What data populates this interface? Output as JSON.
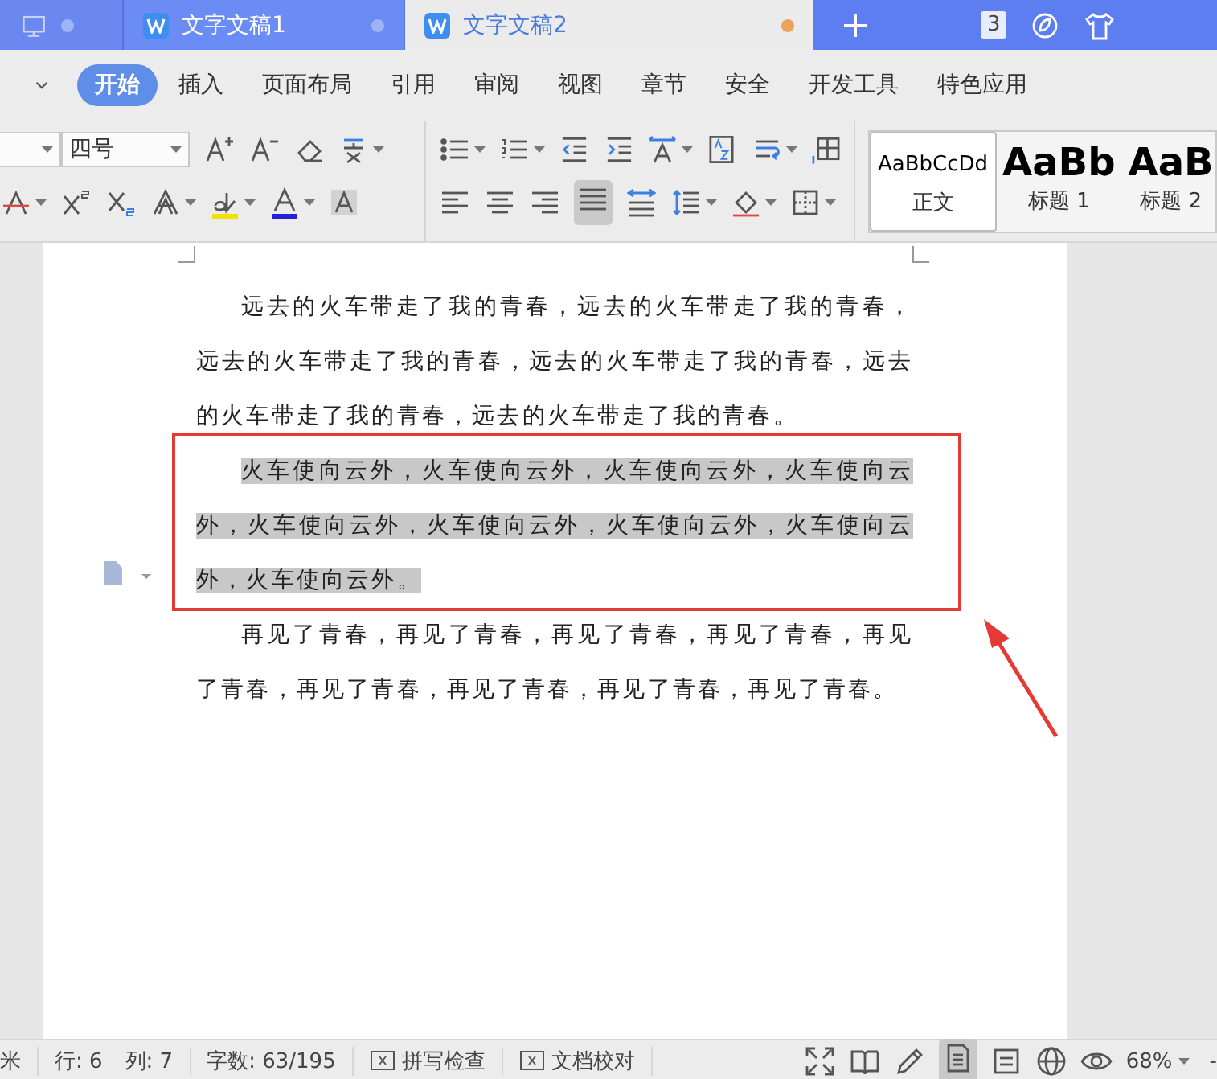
{
  "window_tabs": [
    {
      "kind": "home",
      "selected": false,
      "unsaved": false
    },
    {
      "kind": "doc",
      "title": "文字文稿1",
      "selected": false,
      "unsaved": false
    },
    {
      "kind": "doc",
      "title": "文字文稿2",
      "selected": true,
      "unsaved": true
    }
  ],
  "window_count": "3",
  "ribbon_tabs": [
    {
      "label": "开始",
      "selected": true
    },
    {
      "label": "插入",
      "selected": false
    },
    {
      "label": "页面布局",
      "selected": false
    },
    {
      "label": "引用",
      "selected": false
    },
    {
      "label": "审阅",
      "selected": false
    },
    {
      "label": "视图",
      "selected": false
    },
    {
      "label": "章节",
      "selected": false
    },
    {
      "label": "安全",
      "selected": false
    },
    {
      "label": "开发工具",
      "selected": false
    },
    {
      "label": "特色应用",
      "selected": false
    }
  ],
  "font_size": "四号",
  "styles": [
    {
      "kind": "body",
      "preview": "AaBbCcDd",
      "name": "正文",
      "selected": true
    },
    {
      "kind": "heading",
      "preview": "AaBb",
      "name": "标题 1",
      "selected": false
    },
    {
      "kind": "heading",
      "preview": "AaB",
      "name": "标题 2",
      "selected": false
    }
  ],
  "paragraphs": [
    {
      "text": "远去的火车带走了我的青春，远去的火车带走了我的青春，远去的火车带走了我的青春，远去的火车带走了我的青春，远去的火车带走了我的青春，远去的火车带走了我的青春。",
      "selected": false
    },
    {
      "text": "火车使向云外，火车使向云外，火车使向云外，火车使向云外，火车使向云外，火车使向云外，火车使向云外，火车使向云外，火车使向云外。",
      "selected": true
    },
    {
      "text": "再见了青春，再见了青春，再见了青春，再见了青春，再见了青春，再见了青春，再见了青春，再见了青春，再见了青春。",
      "selected": false
    }
  ],
  "status_bar": {
    "cut_text": "米",
    "line": "行: 6",
    "column": "列: 7",
    "word_count": "字数: 63/195",
    "buttons": [
      "拼写检查",
      "文档校对"
    ],
    "zoom": "68%",
    "cut_edge": "-"
  }
}
